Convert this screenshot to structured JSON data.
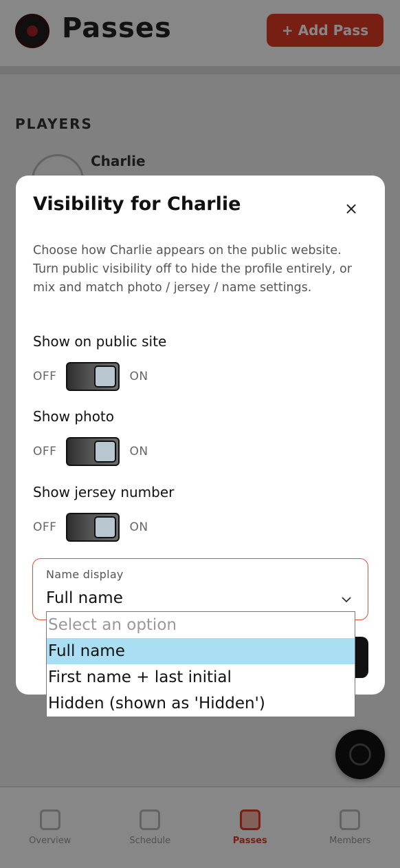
{
  "app": {
    "title": "Passes",
    "add_button": "+ Add Pass",
    "section_label": "PLAYERS",
    "player_name": "Charlie"
  },
  "tabbar": {
    "items": [
      {
        "label": "Overview",
        "active": false
      },
      {
        "label": "Schedule",
        "active": false
      },
      {
        "label": "Passes",
        "active": true
      },
      {
        "label": "Members",
        "active": false
      }
    ]
  },
  "modal": {
    "title": "Visibility for Charlie",
    "close_label": "×",
    "description": "Choose how Charlie appears on the public website. Turn public visibility off to hide the profile entirely, or mix and match photo / jersey / name settings.",
    "toggles": [
      {
        "label": "Show on public site",
        "off": "OFF",
        "on": "ON",
        "value": true
      },
      {
        "label": "Show photo",
        "off": "OFF",
        "on": "ON",
        "value": true
      },
      {
        "label": "Show jersey number",
        "off": "OFF",
        "on": "ON",
        "value": true
      }
    ],
    "name_display": {
      "label": "Name display",
      "value": "Full name",
      "options": [
        "Select an option",
        "Full name",
        "First name + last initial",
        "Hidden (shown as 'Hidden')"
      ]
    }
  },
  "colors": {
    "accent": "#e23b24",
    "select_border": "#e0502f",
    "highlight": "#a9def3"
  },
  "icons": {
    "close": "close-icon",
    "chevron": "chevron-down-icon"
  }
}
